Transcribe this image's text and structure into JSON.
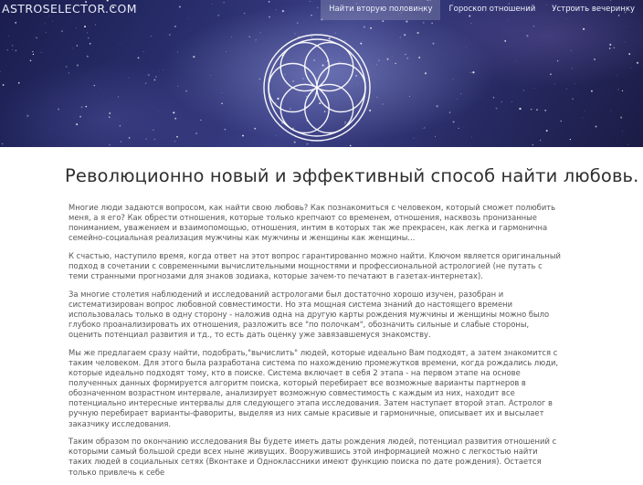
{
  "header": {
    "logo": "ASTROSELECTOR.COM",
    "nav": [
      {
        "label": "Найти вторую половинку",
        "active": true
      },
      {
        "label": "Гороскоп отношений",
        "active": false
      },
      {
        "label": "Устроить вечеринку",
        "active": false
      }
    ]
  },
  "main": {
    "title": "Революционно новый и эффективный способ найти любовь.",
    "paragraphs": [
      "Многие люди задаются вопросом, как найти свою любовь? Как познакомиться с человеком, который сможет полюбить меня, а я его? Как обрести отношения, которые только крепчают со временем, отношения, насквозь пронизанные пониманием, уважением и взаимопомощью, отношения, интим в которых так же прекрасен, как легка и гармонична семейно-социальная реализация мужчины как мужчины и женщины как женщины...",
      "К счастью, наступило время, когда ответ на этот вопрос гарантированно можно найти. Ключом является оригинальный подход в сочетании с современными вычислительными мощностями и профессиональной астрологией (не путать с теми странными прогнозами для знаков зодиака, которые зачем-то печатают в газетах-интернетах).",
      "За многие столетия наблюдений и исследований астрологами был достаточно хорошо изучен, разобран и систематизирован вопрос любовной совместимости. Но эта мощная система знаний до настоящего времени использовалась только в одну сторону - наложив одна на другую карты рождения мужчины и женщины можно было глубоко проанализировать их отношения, разложить все \"по полочкам\", обозначить сильные и слабые стороны, оценить потенциал развития и тд., то есть дать оценку уже завязавшемуся знакомству.",
      "Мы же предлагаем сразу найти, подобрать,\"вычислить\" людей, которые идеально Вам подходят, а затем знакомится с таким человеком. Для этого была разработана система по нахождению промежутков времени, когда рождались люди, которые идеально подходят тому, кто в поиске. Система включает в себя 2 этапа - на первом этапе на основе полученных данных формируется алгоритм поиска, который перебирает все возможные варианты партнеров в обозначенном возрастном интервале, анализирует возможную совместимость с каждым из них, находит все потенциально интересные интервалы для следующего этапа исследования. Затем наступает второй этап. Астролог в ручную перебирает варианты-фавориты, выделяя из них самые красивые и гармоничные, описывает их и высылает заказчику исследования.",
      "Таким образом по окончанию исследования Вы будете иметь даты рождения людей, потенциал развития отношений с которыми самый большой среди всех ныне живущих. Вооружившись этой информацией можно с легкостью найти таких людей в социальных сетях (Вконтаке и Одноклассники имеют функцию поиска по дате рождения). Остается только привлечь к себе"
    ]
  },
  "icons": {
    "emblem": "flower-of-life-icon"
  }
}
